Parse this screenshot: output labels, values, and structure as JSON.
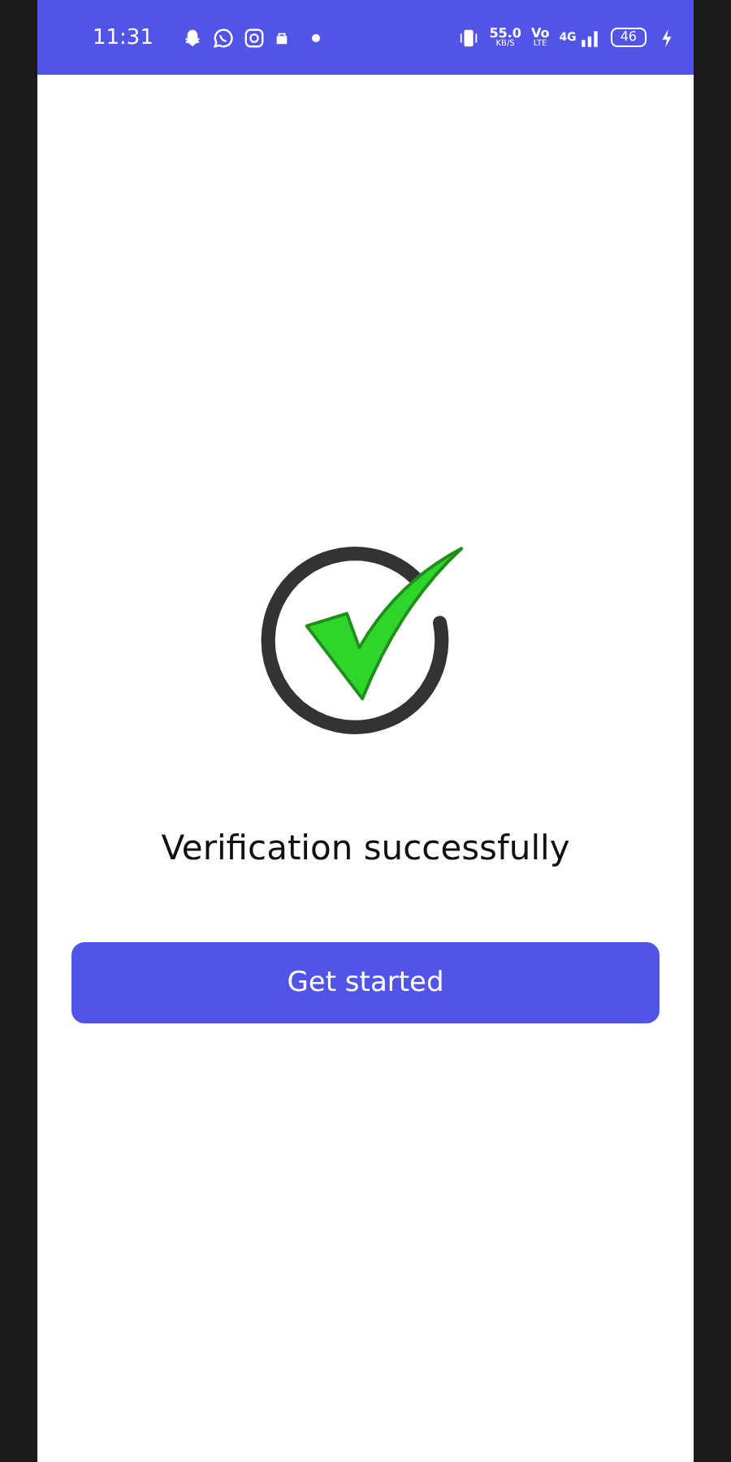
{
  "status_bar": {
    "time": "11:31",
    "speed": "55.0",
    "speed_unit": "KB/S",
    "volte_top": "Vo",
    "volte_bottom": "LTE",
    "network": "4G",
    "battery": "46"
  },
  "message": "Verification successfully",
  "button": "Get started"
}
